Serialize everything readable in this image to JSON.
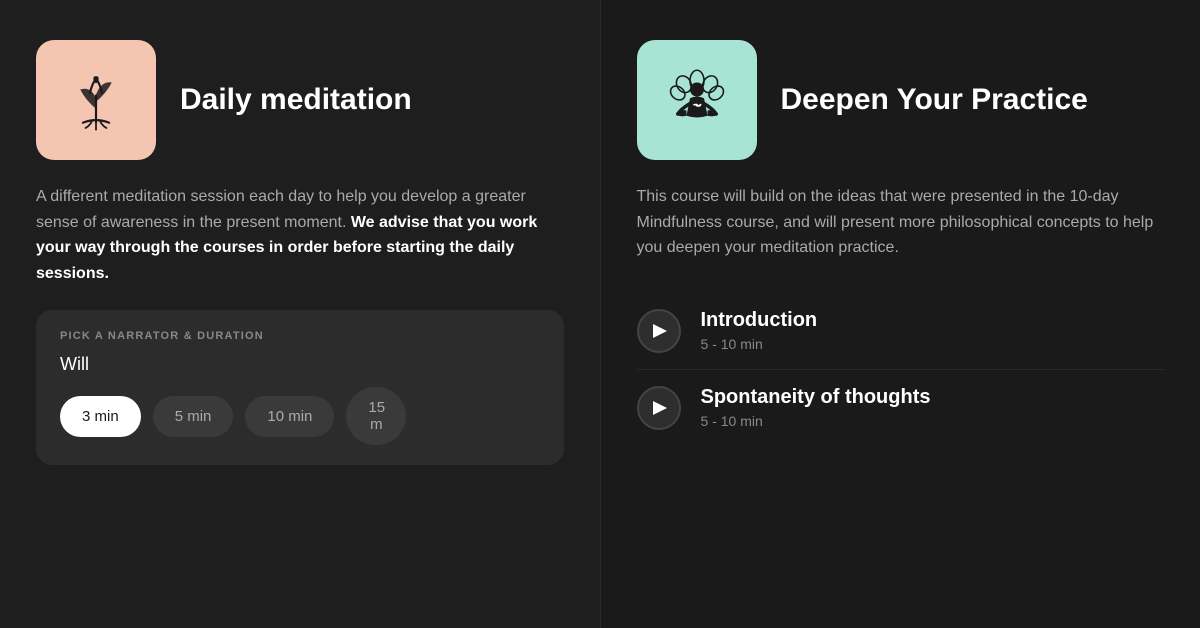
{
  "left": {
    "icon_bg": "#f4c5b0",
    "title": "Daily meditation",
    "description_plain": "A different meditation session each day to help you develop a greater sense of awareness in the present moment. ",
    "description_bold": "We advise that you work your way through the courses in order before starting the daily sessions.",
    "picker": {
      "label": "PICK A NARRATOR & DURATION",
      "narrator": "Will",
      "durations": [
        {
          "label": "3 min",
          "active": true
        },
        {
          "label": "5 min",
          "active": false
        },
        {
          "label": "10 min",
          "active": false
        },
        {
          "label": "15 m",
          "active": false,
          "partial": true
        }
      ]
    }
  },
  "right": {
    "icon_bg": "#a8e4d4",
    "title": "Deepen Your Practice",
    "description": "This course will build on the ideas that were presented in the 10-day Mindfulness course, and will present more philosophical concepts to help you deepen your meditation practice.",
    "lessons": [
      {
        "title": "Introduction",
        "duration": "5 - 10 min"
      },
      {
        "title": "Spontaneity of thoughts",
        "duration": "5 - 10 min"
      }
    ]
  }
}
